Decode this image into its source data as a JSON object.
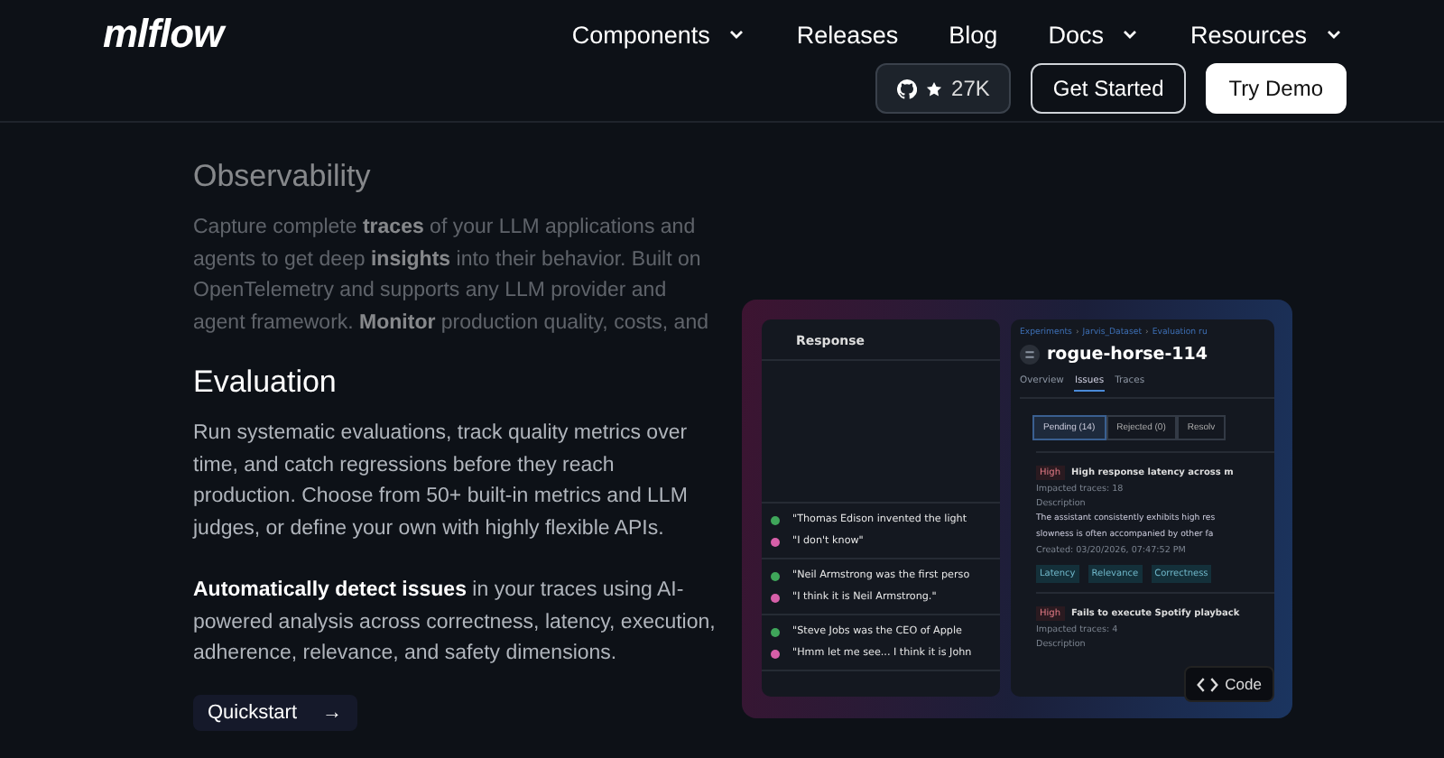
{
  "header": {
    "logo": "mlflow",
    "nav": [
      {
        "label": "Components",
        "has_menu": true
      },
      {
        "label": "Releases",
        "has_menu": false
      },
      {
        "label": "Blog",
        "has_menu": false
      },
      {
        "label": "Docs",
        "has_menu": true
      },
      {
        "label": "Resources",
        "has_menu": true
      }
    ],
    "buttons": [
      {
        "kind": "github",
        "label": "27K"
      },
      {
        "kind": "outline",
        "label": "Get Started"
      },
      {
        "kind": "filled",
        "label": "Try Demo"
      }
    ]
  },
  "sections": [
    {
      "title": "Observability",
      "faded": true,
      "paragraphs": [
        "Capture complete **traces** of your LLM applications and agents to get deep **insights** into their behavior. Built on OpenTelemetry and supports any LLM provider and agent framework. **Monitor** production quality, costs, and"
      ]
    },
    {
      "title": "Evaluation",
      "faded": false,
      "paragraphs": [
        "Run systematic evaluations, track quality metrics over time, and catch regressions before they reach production. Choose from 50+ built-in metrics and LLM judges, or define your own with highly flexible APIs.",
        "**Automatically detect issues** in your traces using AI-powered analysis across correctness, latency, execution, adherence, relevance, and safety dimensions."
      ]
    }
  ],
  "quickstart": {
    "label": "Quickstart",
    "arrow": "→"
  },
  "preview": {
    "response_panel": {
      "heading": "Response",
      "groups": [
        [
          {
            "text": "\"Thomas Edison invented the light",
            "color": "#3fa65a"
          },
          {
            "text": "\"I don't know\"",
            "color": "#d65fa8"
          }
        ],
        [
          {
            "text": "\"Neil Armstrong was the first perso",
            "color": "#3fa65a"
          },
          {
            "text": "\"I think it is Neil Armstrong.\"",
            "color": "#d65fa8"
          }
        ],
        [
          {
            "text": "\"Steve Jobs was the CEO of Apple",
            "color": "#3fa65a"
          },
          {
            "text": "\"Hmm let me see... I think it is John",
            "color": "#d65fa8"
          }
        ]
      ]
    },
    "run_panel": {
      "breadcrumb": [
        {
          "label": "Experiments"
        },
        {
          "sep": "›",
          "label": "Jarvis_Dataset"
        },
        {
          "sep": "›",
          "label": "Evaluation ru"
        }
      ],
      "title": "rogue-horse-114",
      "tabs": [
        {
          "label": "Overview",
          "selected": false
        },
        {
          "label": "Issues",
          "selected": true
        },
        {
          "label": "Traces",
          "selected": false
        }
      ],
      "filters": [
        {
          "label": "Pending (14)",
          "selected": true
        },
        {
          "label": "Rejected (0)",
          "selected": false
        },
        {
          "label": "Resolv",
          "selected": false
        }
      ],
      "issues": [
        {
          "severity": "High",
          "title": "High response latency across m",
          "impacted": "Impacted traces: 18",
          "description_label": "Description",
          "description": [
            "The assistant consistently exhibits high res",
            "slowness is often accompanied by other fa"
          ],
          "created": "Created: 03/20/2026, 07:47:52 PM",
          "tags": [
            "Latency",
            "Relevance",
            "Correctness"
          ]
        },
        {
          "severity": "High",
          "title": "Fails to execute Spotify playback",
          "impacted": "Impacted traces: 4",
          "description_label": "Description"
        }
      ]
    },
    "code_button": {
      "label": "Code"
    }
  }
}
